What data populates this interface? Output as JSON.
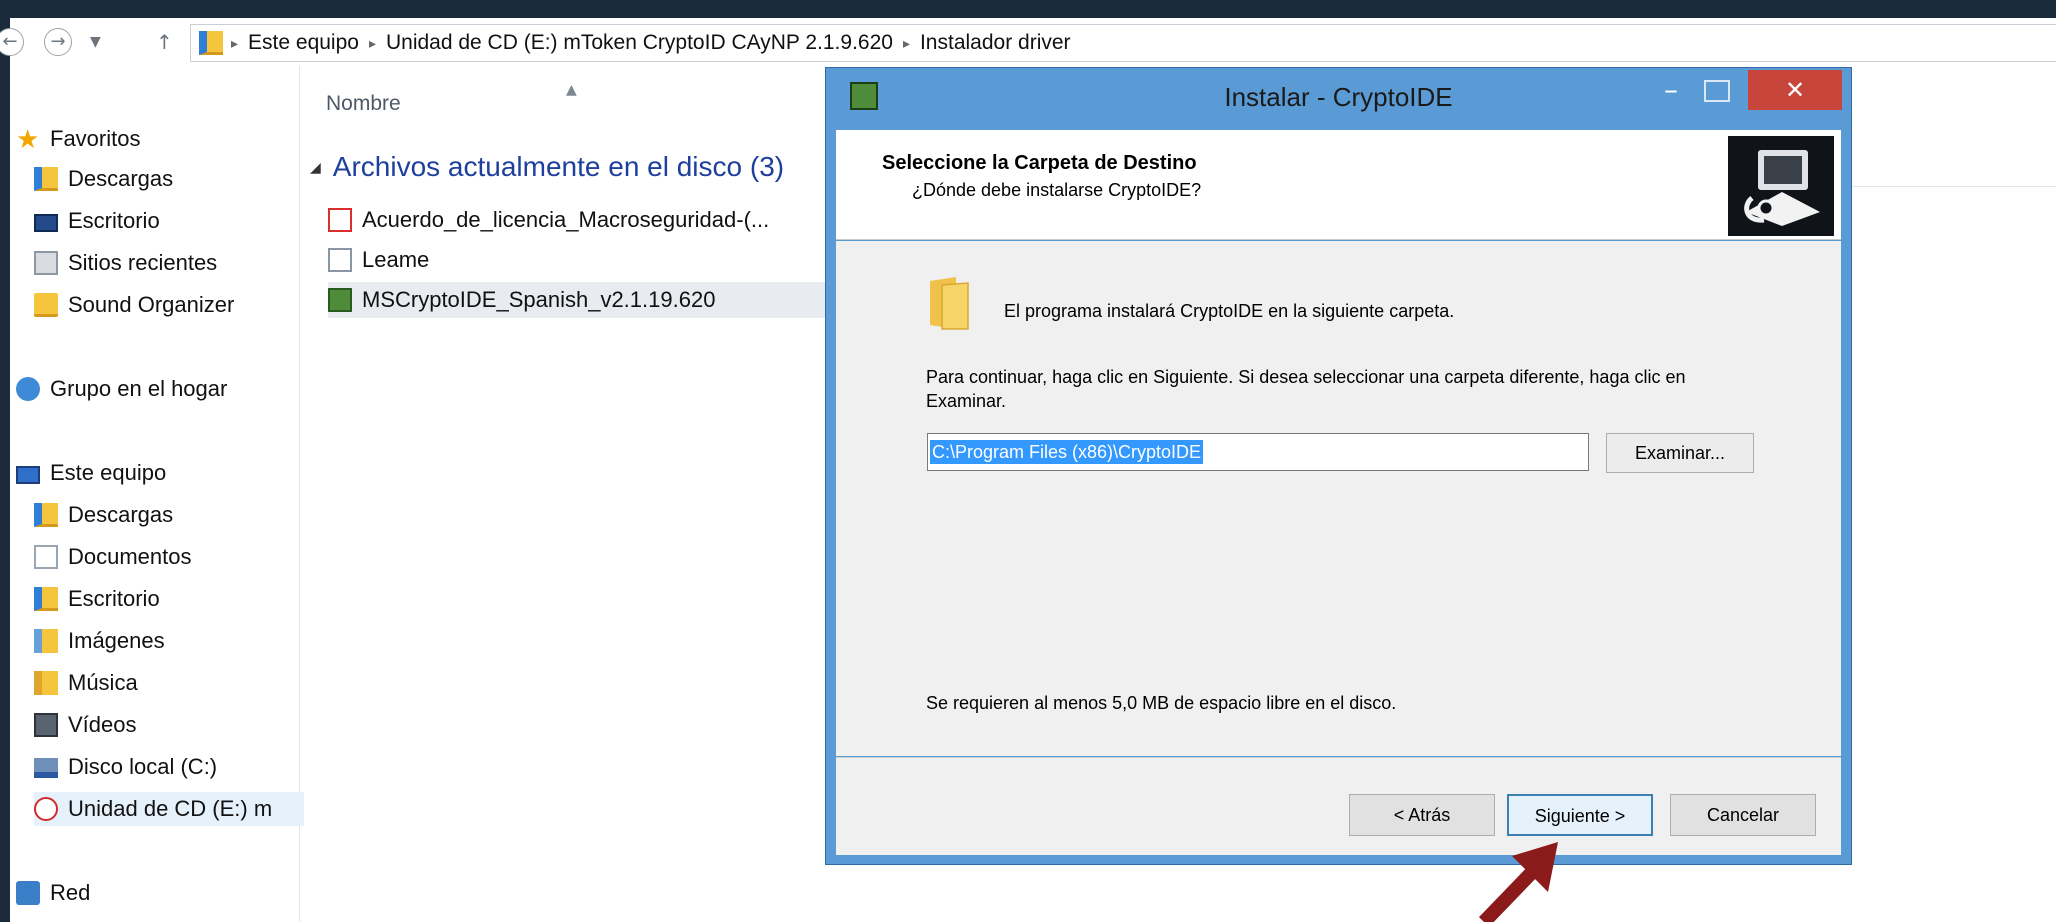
{
  "colors": {
    "desktop_background": "#1b2a3a",
    "dialog_frame": "#5b9bd5",
    "close_button": "#c7453b",
    "selection": "#3399ff",
    "group_header": "#1e3f9e",
    "annotation_arrow": "#8b1a1a"
  },
  "address_bar": {
    "crumbs": [
      "Este equipo",
      "Unidad de CD (E:) mToken CryptoID CAyNP 2.1.9.620",
      "Instalador driver"
    ],
    "separator": "▸",
    "back_icon": "back-arrow-icon",
    "forward_icon": "forward-arrow-icon",
    "recent_icon": "chevron-down-icon",
    "up_icon": "up-arrow-icon"
  },
  "nav_tree": {
    "favorites": {
      "label": "Favoritos",
      "icon": "star-icon"
    },
    "favorite_items": [
      {
        "label": "Descargas",
        "icon": "downloads-folder-icon"
      },
      {
        "label": "Escritorio",
        "icon": "desktop-icon"
      },
      {
        "label": "Sitios recientes",
        "icon": "recent-places-icon"
      },
      {
        "label": "Sound Organizer",
        "icon": "folder-icon"
      }
    ],
    "homegroup": {
      "label": "Grupo en el hogar",
      "icon": "homegroup-icon"
    },
    "this_pc": {
      "label": "Este equipo",
      "icon": "computer-icon"
    },
    "pc_items": [
      {
        "label": "Descargas",
        "icon": "downloads-folder-icon"
      },
      {
        "label": "Documentos",
        "icon": "documents-folder-icon"
      },
      {
        "label": "Escritorio",
        "icon": "desktop-folder-icon"
      },
      {
        "label": "Imágenes",
        "icon": "pictures-folder-icon"
      },
      {
        "label": "Música",
        "icon": "music-folder-icon"
      },
      {
        "label": "Vídeos",
        "icon": "videos-folder-icon"
      },
      {
        "label": "Disco local (C:)",
        "icon": "drive-icon"
      },
      {
        "label": "Unidad de CD (E:) m",
        "icon": "cd-drive-icon"
      }
    ],
    "network": {
      "label": "Red",
      "icon": "network-icon"
    }
  },
  "file_list": {
    "column_name": "Nombre",
    "group_label": "Archivos actualmente en el disco (3)",
    "files": [
      {
        "name": "Acuerdo_de_licencia_Macroseguridad-(...",
        "icon": "pdf-file-icon"
      },
      {
        "name": "Leame",
        "icon": "text-file-icon"
      },
      {
        "name": "MSCryptoIDE_Spanish_v2.1.19.620",
        "icon": "setup-file-icon"
      }
    ]
  },
  "dialog": {
    "title": "Instalar - CryptoIDE",
    "minimize": "–",
    "close": "✕",
    "header_title": "Seleccione la Carpeta de Destino",
    "header_subtitle": "¿Dónde debe instalarse CryptoIDE?",
    "intro": "El programa instalará CryptoIDE en la siguiente carpeta.",
    "instructions": "Para continuar, haga clic en Siguiente. Si desea seleccionar una carpeta diferente, haga clic en Examinar.",
    "path_value": "C:\\Program Files (x86)\\CryptoIDE",
    "browse_label": "Examinar...",
    "space_note": "Se requieren al menos 5,0 MB de espacio libre en el disco.",
    "back_label": "< Atrás",
    "next_label": "Siguiente >",
    "cancel_label": "Cancelar"
  }
}
